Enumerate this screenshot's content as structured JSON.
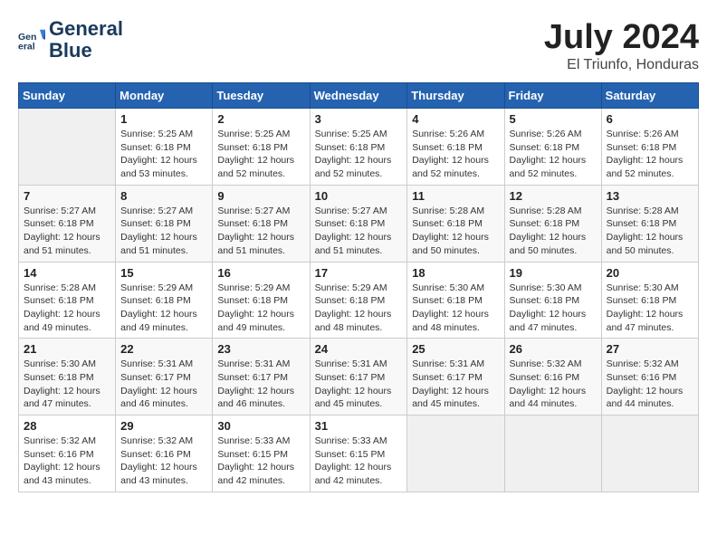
{
  "header": {
    "logo_line1": "General",
    "logo_line2": "Blue",
    "month_title": "July 2024",
    "subtitle": "El Triunfo, Honduras"
  },
  "days_of_week": [
    "Sunday",
    "Monday",
    "Tuesday",
    "Wednesday",
    "Thursday",
    "Friday",
    "Saturday"
  ],
  "weeks": [
    [
      {
        "day": "",
        "info": ""
      },
      {
        "day": "1",
        "info": "Sunrise: 5:25 AM\nSunset: 6:18 PM\nDaylight: 12 hours\nand 53 minutes."
      },
      {
        "day": "2",
        "info": "Sunrise: 5:25 AM\nSunset: 6:18 PM\nDaylight: 12 hours\nand 52 minutes."
      },
      {
        "day": "3",
        "info": "Sunrise: 5:25 AM\nSunset: 6:18 PM\nDaylight: 12 hours\nand 52 minutes."
      },
      {
        "day": "4",
        "info": "Sunrise: 5:26 AM\nSunset: 6:18 PM\nDaylight: 12 hours\nand 52 minutes."
      },
      {
        "day": "5",
        "info": "Sunrise: 5:26 AM\nSunset: 6:18 PM\nDaylight: 12 hours\nand 52 minutes."
      },
      {
        "day": "6",
        "info": "Sunrise: 5:26 AM\nSunset: 6:18 PM\nDaylight: 12 hours\nand 52 minutes."
      }
    ],
    [
      {
        "day": "7",
        "info": "Sunrise: 5:27 AM\nSunset: 6:18 PM\nDaylight: 12 hours\nand 51 minutes."
      },
      {
        "day": "8",
        "info": "Sunrise: 5:27 AM\nSunset: 6:18 PM\nDaylight: 12 hours\nand 51 minutes."
      },
      {
        "day": "9",
        "info": "Sunrise: 5:27 AM\nSunset: 6:18 PM\nDaylight: 12 hours\nand 51 minutes."
      },
      {
        "day": "10",
        "info": "Sunrise: 5:27 AM\nSunset: 6:18 PM\nDaylight: 12 hours\nand 51 minutes."
      },
      {
        "day": "11",
        "info": "Sunrise: 5:28 AM\nSunset: 6:18 PM\nDaylight: 12 hours\nand 50 minutes."
      },
      {
        "day": "12",
        "info": "Sunrise: 5:28 AM\nSunset: 6:18 PM\nDaylight: 12 hours\nand 50 minutes."
      },
      {
        "day": "13",
        "info": "Sunrise: 5:28 AM\nSunset: 6:18 PM\nDaylight: 12 hours\nand 50 minutes."
      }
    ],
    [
      {
        "day": "14",
        "info": "Sunrise: 5:28 AM\nSunset: 6:18 PM\nDaylight: 12 hours\nand 49 minutes."
      },
      {
        "day": "15",
        "info": "Sunrise: 5:29 AM\nSunset: 6:18 PM\nDaylight: 12 hours\nand 49 minutes."
      },
      {
        "day": "16",
        "info": "Sunrise: 5:29 AM\nSunset: 6:18 PM\nDaylight: 12 hours\nand 49 minutes."
      },
      {
        "day": "17",
        "info": "Sunrise: 5:29 AM\nSunset: 6:18 PM\nDaylight: 12 hours\nand 48 minutes."
      },
      {
        "day": "18",
        "info": "Sunrise: 5:30 AM\nSunset: 6:18 PM\nDaylight: 12 hours\nand 48 minutes."
      },
      {
        "day": "19",
        "info": "Sunrise: 5:30 AM\nSunset: 6:18 PM\nDaylight: 12 hours\nand 47 minutes."
      },
      {
        "day": "20",
        "info": "Sunrise: 5:30 AM\nSunset: 6:18 PM\nDaylight: 12 hours\nand 47 minutes."
      }
    ],
    [
      {
        "day": "21",
        "info": "Sunrise: 5:30 AM\nSunset: 6:18 PM\nDaylight: 12 hours\nand 47 minutes."
      },
      {
        "day": "22",
        "info": "Sunrise: 5:31 AM\nSunset: 6:17 PM\nDaylight: 12 hours\nand 46 minutes."
      },
      {
        "day": "23",
        "info": "Sunrise: 5:31 AM\nSunset: 6:17 PM\nDaylight: 12 hours\nand 46 minutes."
      },
      {
        "day": "24",
        "info": "Sunrise: 5:31 AM\nSunset: 6:17 PM\nDaylight: 12 hours\nand 45 minutes."
      },
      {
        "day": "25",
        "info": "Sunrise: 5:31 AM\nSunset: 6:17 PM\nDaylight: 12 hours\nand 45 minutes."
      },
      {
        "day": "26",
        "info": "Sunrise: 5:32 AM\nSunset: 6:16 PM\nDaylight: 12 hours\nand 44 minutes."
      },
      {
        "day": "27",
        "info": "Sunrise: 5:32 AM\nSunset: 6:16 PM\nDaylight: 12 hours\nand 44 minutes."
      }
    ],
    [
      {
        "day": "28",
        "info": "Sunrise: 5:32 AM\nSunset: 6:16 PM\nDaylight: 12 hours\nand 43 minutes."
      },
      {
        "day": "29",
        "info": "Sunrise: 5:32 AM\nSunset: 6:16 PM\nDaylight: 12 hours\nand 43 minutes."
      },
      {
        "day": "30",
        "info": "Sunrise: 5:33 AM\nSunset: 6:15 PM\nDaylight: 12 hours\nand 42 minutes."
      },
      {
        "day": "31",
        "info": "Sunrise: 5:33 AM\nSunset: 6:15 PM\nDaylight: 12 hours\nand 42 minutes."
      },
      {
        "day": "",
        "info": ""
      },
      {
        "day": "",
        "info": ""
      },
      {
        "day": "",
        "info": ""
      }
    ]
  ]
}
